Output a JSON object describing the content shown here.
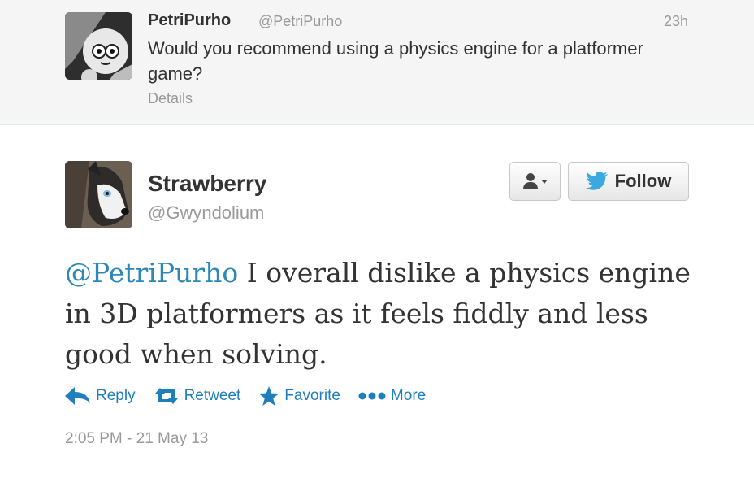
{
  "parent_tweet": {
    "name": "PetriPurho",
    "handle": "@PetriPurho",
    "time": "23h",
    "text": "Would you recommend using a physics engine for a platformer game?",
    "details_label": "Details",
    "avatar_icon": "cartoon-face-avatar"
  },
  "tweet": {
    "name": "Strawberry",
    "handle": "@Gwyndolium",
    "avatar_icon": "husky-avatar",
    "mention": "@PetriPurho",
    "text": " I overall dislike a physics engine in 3D platformers as it feels fiddly and less good when solving.",
    "follow_label": "Follow",
    "user_menu_icon": "user-dropdown-icon",
    "timestamp": "2:05 PM - 21 May 13"
  },
  "actions": [
    {
      "label": "Reply",
      "icon": "reply-icon"
    },
    {
      "label": "Retweet",
      "icon": "retweet-icon"
    },
    {
      "label": "Favorite",
      "icon": "star-icon"
    },
    {
      "label": "More",
      "icon": "more-dots-icon"
    }
  ],
  "colors": {
    "link": "#2b88b8",
    "action": "#1f7fbc",
    "muted": "#999999",
    "parent_bg": "#f5f5f5",
    "twitter_blue": "#3aa9e0"
  }
}
